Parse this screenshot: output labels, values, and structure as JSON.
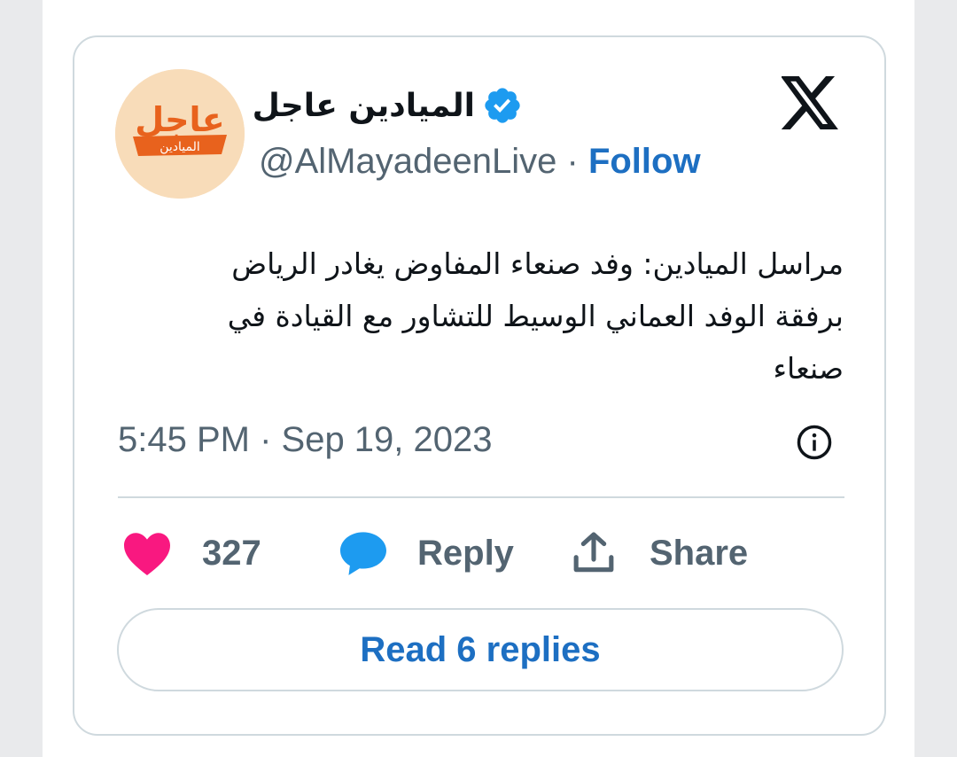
{
  "author": {
    "display_name": "الميادين عاجل",
    "handle": "@AlMayadeenLive",
    "separator": "·",
    "follow_label": "Follow",
    "verified_icon": "verified-badge-icon",
    "avatar_logo_text": "عاجل",
    "avatar_logo_subtext": "الميادين"
  },
  "platform_icon": "x-logo-icon",
  "tweet": {
    "text": "مراسل الميادين: وفد صنعاء المفاوض يغادر الرياض\nبرفقة الوفد العماني الوسيط للتشاور مع القيادة في\nصنعاء",
    "timestamp": "5:45 PM · Sep 19, 2023"
  },
  "actions": {
    "likes_count": "327",
    "reply_label": "Reply",
    "share_label": "Share"
  },
  "read_replies_label": "Read 6 replies",
  "colors": {
    "accent_blue": "#1d6fc2",
    "heart_pink": "#f91880",
    "reply_blue": "#1d9bf0",
    "muted_text": "#536471",
    "border": "#cfd9de"
  }
}
